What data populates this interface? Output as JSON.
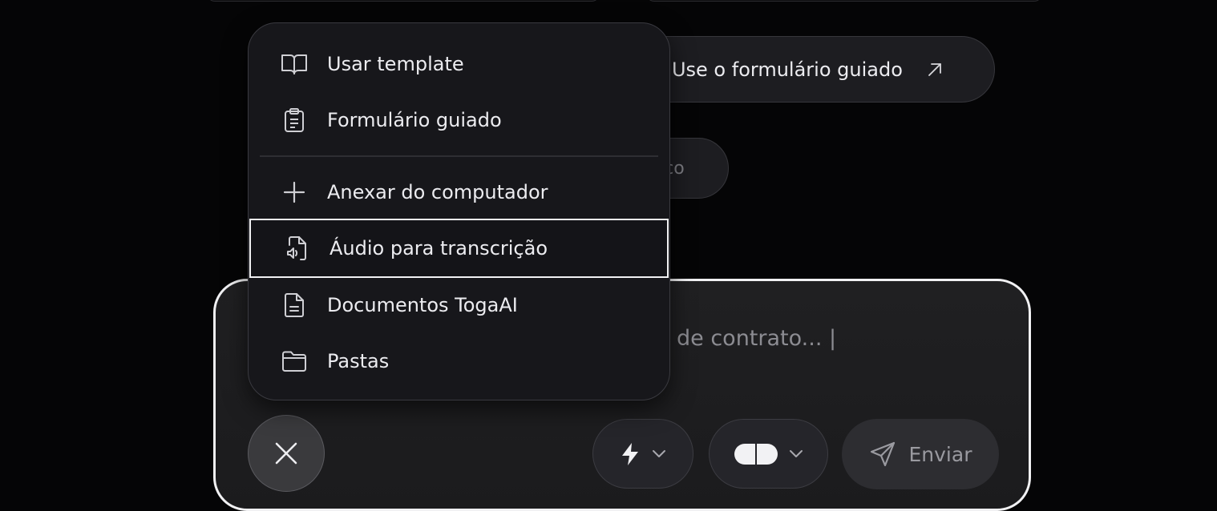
{
  "background_pills": {
    "guided_prompt": "z? Use o formulário guiado",
    "history_label": "rico"
  },
  "menu": {
    "items": [
      {
        "label": "Usar template",
        "icon": "book-open-icon"
      },
      {
        "label": "Formulário guiado",
        "icon": "clipboard-icon"
      },
      {
        "label": "Anexar do computador",
        "icon": "plus-icon"
      },
      {
        "label": "Áudio para transcrição",
        "icon": "audio-file-icon"
      },
      {
        "label": "Documentos TogaAI",
        "icon": "document-icon"
      },
      {
        "label": "Pastas",
        "icon": "folder-icon"
      }
    ],
    "focused_index": 3
  },
  "composer": {
    "placeholder": "de contrato... |",
    "send_label": "Enviar",
    "close_icon": "close-icon",
    "mode_icon": "lightning-icon",
    "model_icon": "toggle-chip-icon"
  },
  "colors": {
    "background": "#050506",
    "menu_bg": "#17171b",
    "composer_border": "#f1f1f3",
    "text": "#ececf0",
    "muted": "#8c8c92"
  }
}
